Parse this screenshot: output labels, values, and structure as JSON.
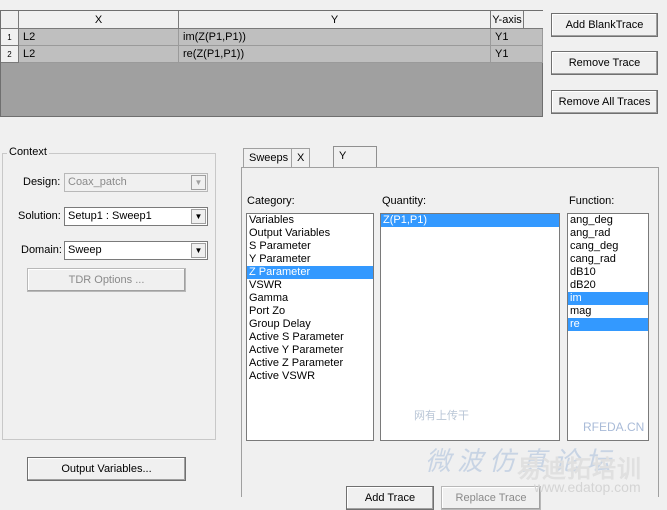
{
  "grid": {
    "headers": {
      "x": "X",
      "y": "Y",
      "yaxis": "Y-axis"
    },
    "rows": [
      {
        "num": "1",
        "x": "L2",
        "y": "im(Z(P1,P1))",
        "yaxis": "Y1"
      },
      {
        "num": "2",
        "x": "L2",
        "y": "re(Z(P1,P1))",
        "yaxis": "Y1"
      }
    ]
  },
  "buttons": {
    "add_blank_trace": "Add BlankTrace",
    "remove_trace": "Remove Trace",
    "remove_all_traces": "Remove All Traces",
    "tdr_options": "TDR Options ...",
    "output_variables": "Output Variables...",
    "add_trace": "Add Trace",
    "replace_trace": "Replace Trace"
  },
  "context": {
    "legend": "Context",
    "design_label": "Design:",
    "design_value": "Coax_patch",
    "solution_label": "Solution:",
    "solution_value": "Setup1 : Sweep1",
    "domain_label": "Domain:",
    "domain_value": "Sweep"
  },
  "tabs": [
    "Sweeps",
    "X",
    "Y"
  ],
  "active_tab": "Y",
  "panel": {
    "category_label": "Category:",
    "quantity_label": "Quantity:",
    "function_label": "Function:",
    "categories": [
      "Variables",
      "Output Variables",
      "S Parameter",
      "Y Parameter",
      "Z Parameter",
      "VSWR",
      "Gamma",
      "Port Zo",
      "Group Delay",
      "Active S Parameter",
      "Active Y Parameter",
      "Active Z Parameter",
      "Active VSWR"
    ],
    "selected_category": "Z Parameter",
    "quantities": [
      "Z(P1,P1)"
    ],
    "selected_quantity": "Z(P1,P1)",
    "functions": [
      "ang_deg",
      "ang_rad",
      "cang_deg",
      "cang_rad",
      "dB10",
      "dB20",
      "im",
      "mag",
      "re"
    ],
    "selected_functions": [
      "im",
      "re"
    ]
  },
  "watermark": {
    "site_cn": "微波仿真论坛",
    "rfeda": "RFEDA.CN",
    "brand_cn": "易迪拓培训",
    "url": "www.edatop.com",
    "small": "网有上传干"
  },
  "colors": {
    "selection": "#3399ff",
    "grid_bg": "#a0a0a0",
    "cell_bg": "#bfbfbf"
  }
}
